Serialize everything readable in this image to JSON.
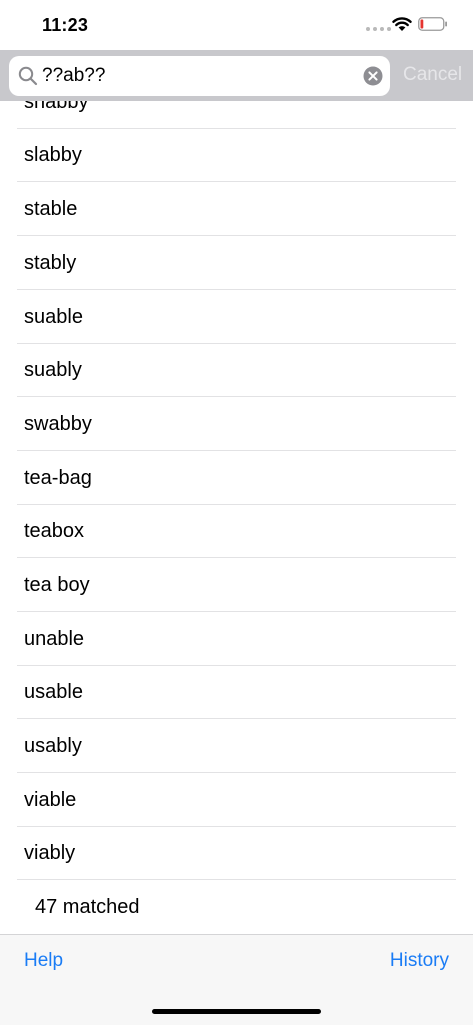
{
  "status_bar": {
    "time": "11:23"
  },
  "search": {
    "query": "??ab??",
    "cancel_label": "Cancel"
  },
  "results": [
    "shabby",
    "slabby",
    "stable",
    "stably",
    "suable",
    "suably",
    "swabby",
    "tea-bag",
    "teabox",
    "tea boy",
    "unable",
    "usable",
    "usably",
    "viable",
    "viably"
  ],
  "matched_text": "47 matched",
  "toolbar": {
    "help_label": "Help",
    "history_label": "History"
  },
  "colors": {
    "accent": "#1a7cf5",
    "search_bar_bg": "#c8c8cc",
    "separator": "#e2e2e4"
  }
}
